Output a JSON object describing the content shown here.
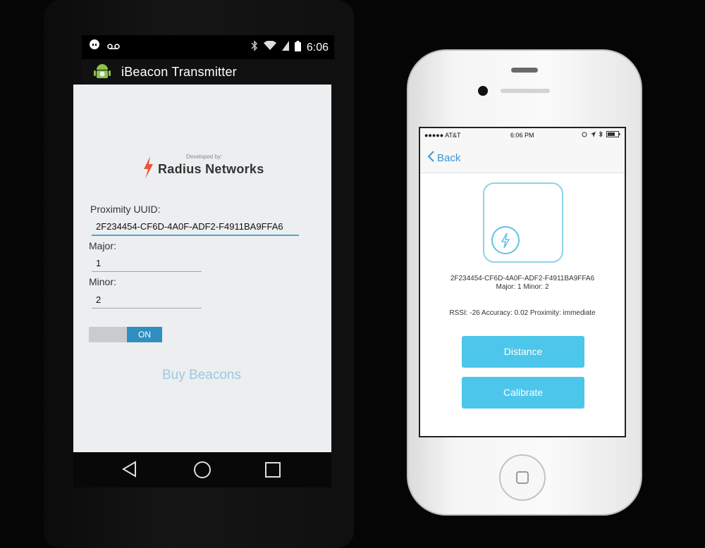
{
  "android": {
    "status": {
      "time": "6:06"
    },
    "actionbar": {
      "title": "iBeacon Transmitter"
    },
    "logo": {
      "developed_by": "Developed by:",
      "company": "Radius Networks"
    },
    "uuid": {
      "label": "Proximity UUID:",
      "value": "2F234454-CF6D-4A0F-ADF2-F4911BA9FFA6"
    },
    "major": {
      "label": "Major:",
      "value": "1"
    },
    "minor": {
      "label": "Minor:",
      "value": "2"
    },
    "toggle": {
      "on_label": "ON",
      "state": true
    },
    "buy_label": "Buy Beacons",
    "nav": {
      "icons": [
        "back-icon",
        "home-icon",
        "recents-icon"
      ]
    }
  },
  "iphone": {
    "status": {
      "carrier": "●●●●● AT&T",
      "time": "6:06 PM"
    },
    "nav": {
      "back_label": "Back"
    },
    "beacon": {
      "uuid": "2F234454-CF6D-4A0F-ADF2-F4911BA9FFA6",
      "major_minor": "Major: 1 Minor: 2",
      "rssi_line": "RSSI: -26 Accuracy: 0.02 Proximity: immediate"
    },
    "buttons": {
      "distance": "Distance",
      "calibrate": "Calibrate"
    }
  },
  "colors": {
    "accent_blue": "#4cc6ea",
    "android_toggle": "#2f8fc0",
    "ios_tint": "#3b95d6",
    "radius_orange": "#e8553b"
  }
}
